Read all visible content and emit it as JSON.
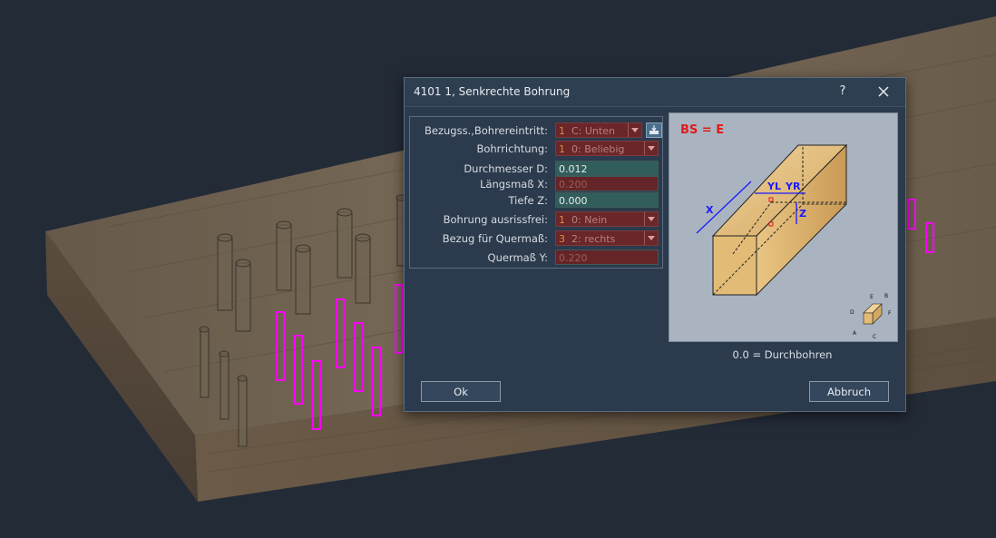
{
  "dialog": {
    "title": "4101 1, Senkrechte Bohrung",
    "help": "?",
    "fields": [
      {
        "label": "Bezugss.,Bohrereintritt:",
        "num": "1",
        "value": "C: Unten"
      },
      {
        "label": "Bohrrichtung:",
        "num": "1",
        "value": "0: Beliebig"
      },
      {
        "label": "Durchmesser D:",
        "value": "0.012"
      },
      {
        "label": "Längsmaß X:",
        "value": "0.200"
      },
      {
        "label": "Tiefe Z:",
        "value": "0.000"
      },
      {
        "label": "Bohrung ausrissfrei:",
        "num": "1",
        "value": "0: Nein"
      },
      {
        "label": "Bezug für Quermaß:",
        "num": "3",
        "value": "2: rechts"
      },
      {
        "label": "Quermaß Y:",
        "value": "0.220"
      }
    ],
    "diagram": {
      "bs_label": "BS = E",
      "x_label": "X",
      "yl_label": "YL",
      "yr_label": "YR",
      "z_label": "Z",
      "cube_labels": {
        "a": "A",
        "b": "B",
        "c": "C",
        "d": "D",
        "e": "E",
        "f": "F"
      }
    },
    "hint": "0.0 = Durchbohren",
    "ok_label": "Ok",
    "cancel_label": "Abbruch"
  },
  "colors": {
    "background": "#232b37",
    "dialog": "#2b3a4c",
    "field_green": "#315d5b",
    "field_red": "#652427",
    "drill_highlight": "#ff00ff",
    "annotation_blue": "#1a1aff",
    "bs_red": "#e01a1a"
  }
}
